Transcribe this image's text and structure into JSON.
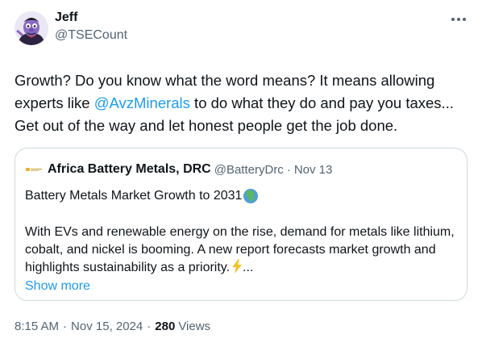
{
  "author": {
    "display_name": "Jeff",
    "handle": "@TSECount"
  },
  "more_icon": "more-horizontal-icon",
  "body": {
    "before_mention": "Growth? Do you know what the word means? It means allowing experts like ",
    "mention": "@AvzMinerals",
    "after_mention": " to do what they do and pay you taxes... Get out of the way and let honest people get the job done."
  },
  "quote": {
    "display_name": "Africa Battery Metals, DRC",
    "handle": "@BatteryDrc",
    "separator": "·",
    "date": "Nov 13",
    "title": "Battery Metals Market Growth to 2031",
    "title_icon": "globe-africa-icon",
    "text": "With EVs and renewable energy on the rise, demand for metals like lithium, cobalt, and nickel is booming. A new report forecasts market growth and highlights sustainability as a priority.",
    "text_icon": "lightning-bolt-icon",
    "ellipsis": "...",
    "show_more": "Show more"
  },
  "meta": {
    "time": "8:15 AM",
    "separator": "·",
    "date": "Nov 15, 2024",
    "views_count": "280",
    "views_label": "Views"
  },
  "colors": {
    "link": "#1d9bf0",
    "secondary_text": "#536471",
    "primary_text": "#0f1419",
    "border": "#cfd9de"
  }
}
